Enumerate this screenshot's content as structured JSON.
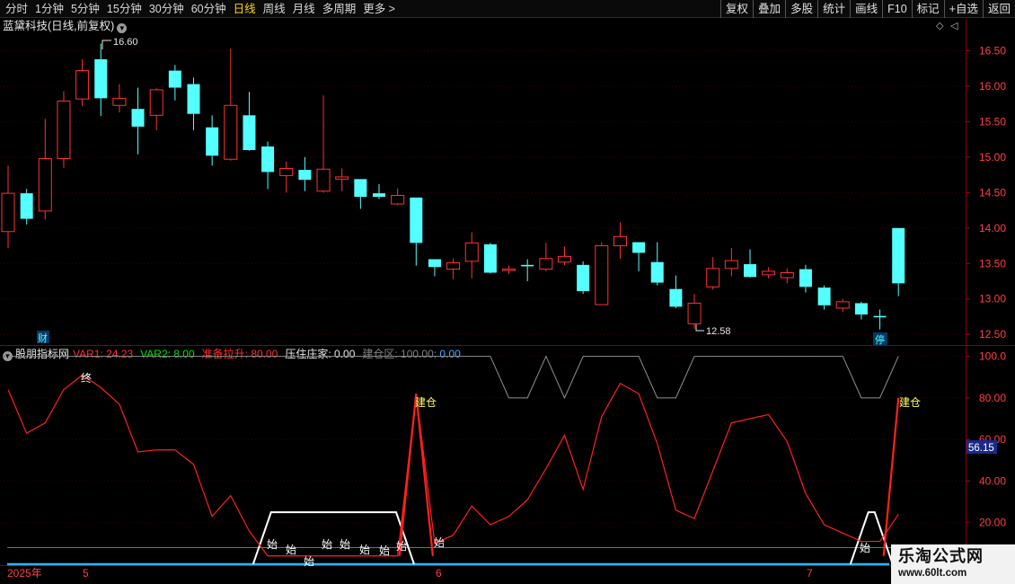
{
  "toolbar": {
    "periods": [
      "分时",
      "1分钟",
      "5分钟",
      "15分钟",
      "30分钟",
      "60分钟",
      "日线",
      "周线",
      "月线",
      "多周期",
      "更多 >"
    ],
    "active_period": "日线",
    "buttons": [
      "复权",
      "叠加",
      "多股",
      "统计",
      "画线",
      "F10",
      "标记",
      "+自选",
      "返回"
    ]
  },
  "main_chart": {
    "title": "蓝黛科技(日线,前复权)",
    "high_label": "16.60",
    "low_label": "12.58",
    "marker_cai": "财",
    "marker_ting": "停",
    "price_ticks": [
      "16.50",
      "16.00",
      "15.50",
      "15.00",
      "14.50",
      "14.00",
      "13.50",
      "13.00",
      "12.50"
    ],
    "colors": {
      "up": "#ff3232",
      "down": "#54ffff",
      "axis": "#8b0000"
    }
  },
  "indicator": {
    "name": "股朋指标网",
    "var1": "VAR1: 24.23",
    "var2": "VAR2: 8.00",
    "zhunbei": "准备拉升: 80.00",
    "yazhu": "压住庄家: 0.00",
    "jiancangqu": "建仓区: 100.00",
    "jiancangqu_extra": ": 0.00",
    "ticks": [
      "100.0",
      "80.00",
      "60.00",
      "40.00",
      "20.00"
    ],
    "current_value": "56.15",
    "label_zhong": "终",
    "label_jiancang": "建仓",
    "label_shi": "始"
  },
  "datebar": {
    "year": "2025年",
    "months": [
      "5",
      "6",
      "7"
    ]
  },
  "watermark": {
    "title": "乐淘公式网",
    "url": "www.60lt.com"
  },
  "chart_data": [
    {
      "type": "candlestick",
      "title": "蓝黛科技(日线,前复权)",
      "ylim": [
        12.35,
        16.95
      ],
      "candles": [
        {
          "o": 13.95,
          "h": 14.88,
          "l": 13.72,
          "c": 14.49
        },
        {
          "o": 14.49,
          "h": 14.55,
          "l": 14.05,
          "c": 14.13
        },
        {
          "o": 14.24,
          "h": 15.54,
          "l": 14.12,
          "c": 14.98
        },
        {
          "o": 14.98,
          "h": 15.93,
          "l": 14.85,
          "c": 15.79
        },
        {
          "o": 15.82,
          "h": 16.38,
          "l": 15.72,
          "c": 16.22
        },
        {
          "o": 16.38,
          "h": 16.6,
          "l": 15.58,
          "c": 15.83
        },
        {
          "o": 15.73,
          "h": 16.03,
          "l": 15.63,
          "c": 15.83
        },
        {
          "o": 15.68,
          "h": 15.98,
          "l": 15.04,
          "c": 15.43
        },
        {
          "o": 15.59,
          "h": 15.97,
          "l": 15.38,
          "c": 15.95
        },
        {
          "o": 16.22,
          "h": 16.3,
          "l": 15.8,
          "c": 15.98
        },
        {
          "o": 16.03,
          "h": 16.12,
          "l": 15.38,
          "c": 15.61
        },
        {
          "o": 15.42,
          "h": 15.59,
          "l": 14.88,
          "c": 15.02
        },
        {
          "o": 14.97,
          "h": 16.53,
          "l": 14.95,
          "c": 15.73
        },
        {
          "o": 15.59,
          "h": 15.92,
          "l": 15.09,
          "c": 15.1
        },
        {
          "o": 15.15,
          "h": 15.22,
          "l": 14.55,
          "c": 14.79
        },
        {
          "o": 14.74,
          "h": 14.94,
          "l": 14.5,
          "c": 14.84
        },
        {
          "o": 14.82,
          "h": 15.0,
          "l": 14.52,
          "c": 14.68
        },
        {
          "o": 14.52,
          "h": 15.87,
          "l": 14.5,
          "c": 14.83
        },
        {
          "o": 14.69,
          "h": 14.84,
          "l": 14.52,
          "c": 14.72
        },
        {
          "o": 14.69,
          "h": 14.69,
          "l": 14.27,
          "c": 14.44
        },
        {
          "o": 14.49,
          "h": 14.62,
          "l": 14.41,
          "c": 14.44
        },
        {
          "o": 14.34,
          "h": 14.56,
          "l": 14.32,
          "c": 14.46
        },
        {
          "o": 14.43,
          "h": 14.43,
          "l": 13.47,
          "c": 13.79
        },
        {
          "o": 13.56,
          "h": 13.56,
          "l": 13.32,
          "c": 13.45
        },
        {
          "o": 13.42,
          "h": 13.57,
          "l": 13.28,
          "c": 13.51
        },
        {
          "o": 13.53,
          "h": 13.94,
          "l": 13.29,
          "c": 13.79
        },
        {
          "o": 13.77,
          "h": 13.79,
          "l": 13.36,
          "c": 13.37
        },
        {
          "o": 13.4,
          "h": 13.47,
          "l": 13.35,
          "c": 13.42
        },
        {
          "o": 13.48,
          "h": 13.56,
          "l": 13.25,
          "c": 13.46
        },
        {
          "o": 13.42,
          "h": 13.79,
          "l": 13.39,
          "c": 13.57
        },
        {
          "o": 13.52,
          "h": 13.74,
          "l": 13.48,
          "c": 13.6
        },
        {
          "o": 13.48,
          "h": 13.53,
          "l": 13.07,
          "c": 13.11
        },
        {
          "o": 12.92,
          "h": 13.8,
          "l": 12.92,
          "c": 13.75
        },
        {
          "o": 13.75,
          "h": 14.08,
          "l": 13.57,
          "c": 13.88
        },
        {
          "o": 13.8,
          "h": 13.8,
          "l": 13.39,
          "c": 13.65
        },
        {
          "o": 13.52,
          "h": 13.8,
          "l": 13.19,
          "c": 13.23
        },
        {
          "o": 13.14,
          "h": 13.33,
          "l": 12.87,
          "c": 12.89
        },
        {
          "o": 12.65,
          "h": 13.07,
          "l": 12.58,
          "c": 12.94
        },
        {
          "o": 13.17,
          "h": 13.59,
          "l": 13.13,
          "c": 13.43
        },
        {
          "o": 13.43,
          "h": 13.72,
          "l": 13.32,
          "c": 13.54
        },
        {
          "o": 13.49,
          "h": 13.7,
          "l": 13.3,
          "c": 13.31
        },
        {
          "o": 13.34,
          "h": 13.45,
          "l": 13.29,
          "c": 13.39
        },
        {
          "o": 13.3,
          "h": 13.43,
          "l": 13.22,
          "c": 13.37
        },
        {
          "o": 13.42,
          "h": 13.48,
          "l": 13.09,
          "c": 13.17
        },
        {
          "o": 13.16,
          "h": 13.19,
          "l": 12.85,
          "c": 12.91
        },
        {
          "o": 12.87,
          "h": 13.0,
          "l": 12.82,
          "c": 12.96
        },
        {
          "o": 12.94,
          "h": 12.96,
          "l": 12.71,
          "c": 12.78
        },
        {
          "o": 12.76,
          "h": 12.85,
          "l": 12.57,
          "c": 12.74
        },
        {
          "o": 14.0,
          "h": 14.0,
          "l": 13.04,
          "c": 13.22
        }
      ]
    },
    {
      "type": "line",
      "title": "股朋指标网",
      "ylim": [
        0,
        105
      ],
      "series": [
        {
          "name": "VAR1",
          "color": "#ff2020",
          "values": [
            84,
            63,
            68,
            84,
            91,
            85,
            77,
            54,
            55,
            55,
            48,
            23,
            33,
            16,
            4,
            4,
            4,
            4,
            4,
            4,
            4,
            4,
            82,
            10,
            14,
            28,
            19,
            23,
            31,
            46,
            62,
            36,
            71,
            87,
            82,
            58,
            26,
            22,
            45,
            68,
            70,
            72,
            59,
            34,
            19,
            15,
            11,
            11,
            24
          ]
        },
        {
          "name": "建仓区",
          "color": "#909090",
          "values": [
            100,
            100,
            100,
            100,
            100,
            100,
            100,
            100,
            100,
            100,
            100,
            100,
            100,
            100,
            100,
            100,
            100,
            100,
            100,
            100,
            100,
            100,
            100,
            100,
            100,
            100,
            100,
            80,
            80,
            100,
            80,
            100,
            100,
            100,
            100,
            80,
            80,
            100,
            100,
            100,
            100,
            100,
            100,
            100,
            100,
            100,
            80,
            80,
            100
          ]
        },
        {
          "name": "VAR2",
          "color": "#00c000",
          "values": [
            8
          ]
        }
      ]
    }
  ]
}
